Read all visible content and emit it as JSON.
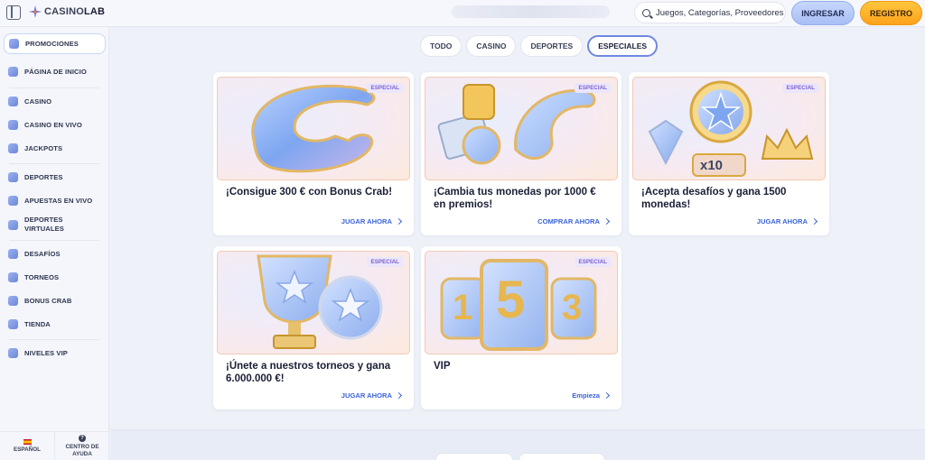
{
  "header": {
    "logo_prefix": "CASINO",
    "logo_suffix": "LAB",
    "search_placeholder": "Juegos, Categorías, Proveedores",
    "login_label": "INGRESAR",
    "register_label": "REGISTRO"
  },
  "sidebar": {
    "items": [
      {
        "label": "PROMOCIONES",
        "icon": "promotions-icon",
        "active": true
      },
      {
        "label": "PÁGINA DE INICIO",
        "icon": "home-icon"
      },
      {
        "label": "CASINO",
        "icon": "casino-chip-icon"
      },
      {
        "label": "CASINO EN VIVO",
        "icon": "live-casino-icon"
      },
      {
        "label": "JACKPOTS",
        "icon": "jackpot-icon"
      },
      {
        "label": "DEPORTES",
        "icon": "sports-icon"
      },
      {
        "label": "APUESTAS EN VIVO",
        "icon": "live-bets-icon"
      },
      {
        "label": "DEPORTES VIRTUALES",
        "icon": "virtual-sports-icon"
      },
      {
        "label": "DESAFÍOS",
        "icon": "challenges-icon"
      },
      {
        "label": "TORNEOS",
        "icon": "trophy-icon"
      },
      {
        "label": "BONUS CRAB",
        "icon": "crab-claw-icon"
      },
      {
        "label": "TIENDA",
        "icon": "shop-icon"
      },
      {
        "label": "NIVELES VIP",
        "icon": "crown-icon"
      }
    ],
    "language_label": "ESPAÑOL",
    "help_label": "CENTRO DE AYUDA"
  },
  "tabs": [
    {
      "label": "TODO"
    },
    {
      "label": "CASINO"
    },
    {
      "label": "DEPORTES"
    },
    {
      "label": "ESPECIALES",
      "active": true
    }
  ],
  "cards": [
    {
      "badge": "ESPECIAL",
      "title": "¡Consigue 300 € con Bonus Crab!",
      "cta": "JUGAR AHORA",
      "art": "crab-claw-art"
    },
    {
      "badge": "ESPECIAL",
      "title": "¡Cambia tus monedas por 1000 € en premios!",
      "cta": "COMPRAR AHORA",
      "art": "coins-exchange-art"
    },
    {
      "badge": "ESPECIAL",
      "title": "¡Acepta desafíos y gana 1500 monedas!",
      "cta": "JUGAR AHORA",
      "art": "star-diamond-crown-art"
    },
    {
      "badge": "ESPECIAL",
      "title": "¡Únete a nuestros torneos y gana 6.000.000 €!",
      "cta": "JUGAR AHORA",
      "art": "trophy-ball-art"
    },
    {
      "badge": "ESPECIAL",
      "title": "VIP",
      "cta": "Empieza",
      "art": "vip-153-art"
    }
  ],
  "art_text": {
    "multiplier": "x10",
    "digits": [
      "1",
      "5",
      "3"
    ]
  },
  "colors": {
    "accent_blue": "#3a63d8",
    "register_orange": "#ffa21c",
    "badge_purple": "#7e5fd3"
  }
}
